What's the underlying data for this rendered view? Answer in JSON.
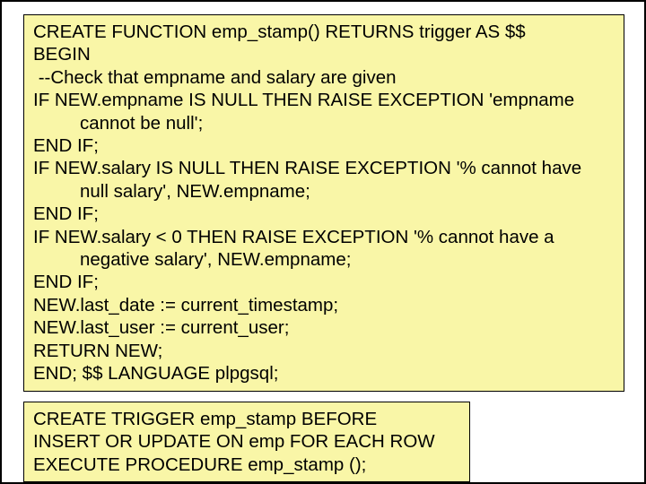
{
  "box1": {
    "l1": "CREATE FUNCTION emp_stamp() RETURNS trigger AS $$",
    "l2": "BEGIN",
    "l3": " --Check that empname and salary are given",
    "l4": "IF NEW.empname IS NULL THEN RAISE EXCEPTION 'empname cannot be null';",
    "l5": "END IF;",
    "l6": "IF NEW.salary IS NULL THEN RAISE EXCEPTION '% cannot have null salary', NEW.empname;",
    "l7": "END IF;",
    "l8": "IF NEW.salary < 0 THEN RAISE EXCEPTION '% cannot have a negative salary', NEW.empname;",
    "l9": "END IF;",
    "l10": "NEW.last_date := current_timestamp;",
    "l11": "NEW.last_user := current_user;",
    "l12": "RETURN NEW;",
    "l13": "END; $$ LANGUAGE plpgsql;"
  },
  "box2": {
    "l1": "CREATE TRIGGER emp_stamp BEFORE",
    "l2": "INSERT OR UPDATE ON emp FOR EACH ROW",
    "l3": "EXECUTE PROCEDURE emp_stamp ();"
  }
}
